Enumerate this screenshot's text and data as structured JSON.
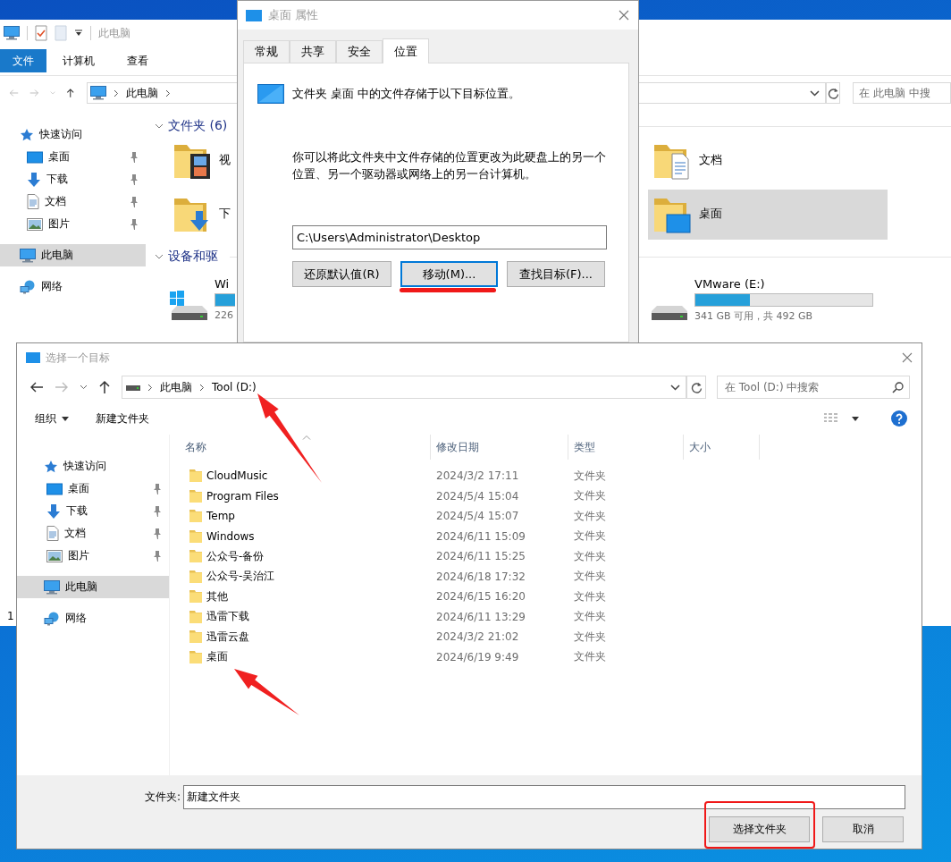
{
  "explorer": {
    "title": "此电脑",
    "ribbon_tabs": [
      {
        "label": "文件",
        "selected": true
      },
      {
        "label": "计算机",
        "selected": false
      },
      {
        "label": "查看",
        "selected": false
      }
    ],
    "address": "此电脑",
    "search": {
      "placeholder": "在 此电脑 中搜"
    },
    "nav": [
      {
        "label": "快速访问",
        "kind": "star",
        "selected": false,
        "children": [
          {
            "label": "桌面",
            "kind": "desktop",
            "pinned": true,
            "selected": false
          },
          {
            "label": "下载",
            "kind": "download",
            "pinned": true,
            "selected": false
          },
          {
            "label": "文档",
            "kind": "document",
            "pinned": true,
            "selected": false
          },
          {
            "label": "图片",
            "kind": "picture",
            "pinned": true,
            "selected": false
          }
        ]
      },
      {
        "label": "此电脑",
        "kind": "pc",
        "selected": true
      },
      {
        "label": "网络",
        "kind": "network",
        "selected": false
      }
    ],
    "groups": [
      {
        "title": "文件夹 (6)",
        "expanded": true,
        "kind": "folders",
        "items": [
          {
            "name": "视",
            "kind": "video",
            "selected": false
          },
          {
            "name": "文档",
            "kind": "document",
            "selected": false
          },
          {
            "name": "下",
            "kind": "download",
            "selected": false
          },
          {
            "name": "桌面",
            "kind": "desktop",
            "selected": true
          }
        ]
      },
      {
        "title": "设备和驱",
        "expanded": true,
        "kind": "drives",
        "items": [
          {
            "name": "Wi",
            "kind": "windows",
            "level": 0.5,
            "free": "226"
          },
          {
            "name": "VMware (E:)",
            "kind": "drive",
            "level": 0.31,
            "free": "341 GB 可用，共 492 GB"
          }
        ]
      }
    ],
    "status": "1"
  },
  "properties": {
    "title": "桌面 属性",
    "tabs": [
      {
        "label": "常规",
        "selected": false
      },
      {
        "label": "共享",
        "selected": false
      },
      {
        "label": "安全",
        "selected": false
      },
      {
        "label": "位置",
        "selected": true
      }
    ],
    "heading": "文件夹 桌面 中的文件存储于以下目标位置。",
    "description": "你可以将此文件夹中文件存储的位置更改为此硬盘上的另一个位置、另一个驱动器或网络上的另一台计算机。",
    "path": "C:\\Users\\Administrator\\Desktop",
    "buttons": [
      {
        "label": "还原默认值(R)",
        "focused": false
      },
      {
        "label": "移动(M)...",
        "focused": true
      },
      {
        "label": "查找目标(F)...",
        "focused": false
      }
    ]
  },
  "chooser": {
    "title": "选择一个目标",
    "breadcrumb": [
      "此电脑",
      "Tool (D:)"
    ],
    "search": {
      "placeholder": "在 Tool (D:) 中搜索"
    },
    "toolbar": [
      {
        "label": "组织",
        "dropdown": true
      },
      {
        "label": "新建文件夹",
        "dropdown": false
      }
    ],
    "nav": [
      {
        "label": "快速访问",
        "kind": "star",
        "selected": false,
        "children": [
          {
            "label": "桌面",
            "kind": "desktop",
            "pinned": true,
            "selected": false
          },
          {
            "label": "下载",
            "kind": "download",
            "pinned": true,
            "selected": false
          },
          {
            "label": "文档",
            "kind": "document",
            "pinned": true,
            "selected": false
          },
          {
            "label": "图片",
            "kind": "picture",
            "pinned": true,
            "selected": false
          }
        ]
      },
      {
        "label": "此电脑",
        "kind": "pc",
        "selected": true
      },
      {
        "label": "网络",
        "kind": "network",
        "selected": false
      }
    ],
    "columns": [
      {
        "label": "名称",
        "sorted": true
      },
      {
        "label": "修改日期",
        "sorted": false
      },
      {
        "label": "类型",
        "sorted": false
      },
      {
        "label": "大小",
        "sorted": false
      }
    ],
    "rows": [
      {
        "name": "CloudMusic",
        "modified": "2024/3/2 17:11",
        "type": "文件夹"
      },
      {
        "name": "Program Files",
        "modified": "2024/5/4 15:04",
        "type": "文件夹"
      },
      {
        "name": "Temp",
        "modified": "2024/5/4 15:07",
        "type": "文件夹"
      },
      {
        "name": "Windows",
        "modified": "2024/6/11 15:09",
        "type": "文件夹"
      },
      {
        "name": "公众号-备份",
        "modified": "2024/6/11 15:25",
        "type": "文件夹"
      },
      {
        "name": "公众号-吴治江",
        "modified": "2024/6/18 17:32",
        "type": "文件夹"
      },
      {
        "name": "其他",
        "modified": "2024/6/15 16:20",
        "type": "文件夹"
      },
      {
        "name": "迅雷下载",
        "modified": "2024/6/11 13:29",
        "type": "文件夹"
      },
      {
        "name": "迅雷云盘",
        "modified": "2024/3/2 21:02",
        "type": "文件夹"
      },
      {
        "name": "桌面",
        "modified": "2024/6/19 9:49",
        "type": "文件夹"
      }
    ],
    "folder_field": {
      "label": "文件夹:",
      "value": "新建文件夹"
    },
    "buttons": [
      "选择文件夹",
      "取消"
    ]
  }
}
